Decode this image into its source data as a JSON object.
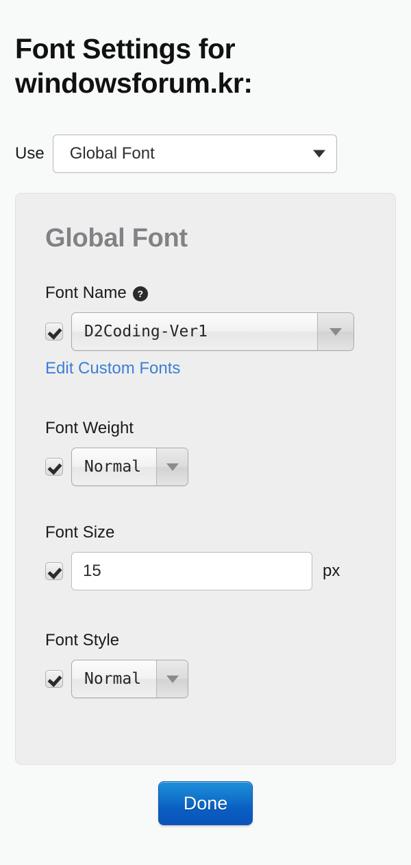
{
  "page": {
    "title": "Font Settings for windowsforum.kr:"
  },
  "use_row": {
    "label": "Use",
    "selected": "Global Font",
    "arrow_icon": "chevron-down-icon"
  },
  "panel": {
    "heading": "Global Font",
    "fields": {
      "font_name": {
        "label": "Font Name",
        "help_icon": "question-mark-icon",
        "checkbox_checked": true,
        "value": "D2Coding-Ver1",
        "link_label": "Edit Custom Fonts"
      },
      "font_weight": {
        "label": "Font Weight",
        "checkbox_checked": true,
        "value": "Normal"
      },
      "font_size": {
        "label": "Font Size",
        "checkbox_checked": true,
        "value": "15",
        "placeholder": "",
        "unit": "px"
      },
      "font_style": {
        "label": "Font Style",
        "checkbox_checked": true,
        "value": "Normal"
      }
    }
  },
  "footer": {
    "done_label": "Done"
  },
  "colors": {
    "background": "#f8f9f9",
    "panel": "#eeeeee",
    "heading": "#808285",
    "link": "#3b7fd4",
    "done_button": "#0f6cc6",
    "text": "#1a1a1a"
  }
}
